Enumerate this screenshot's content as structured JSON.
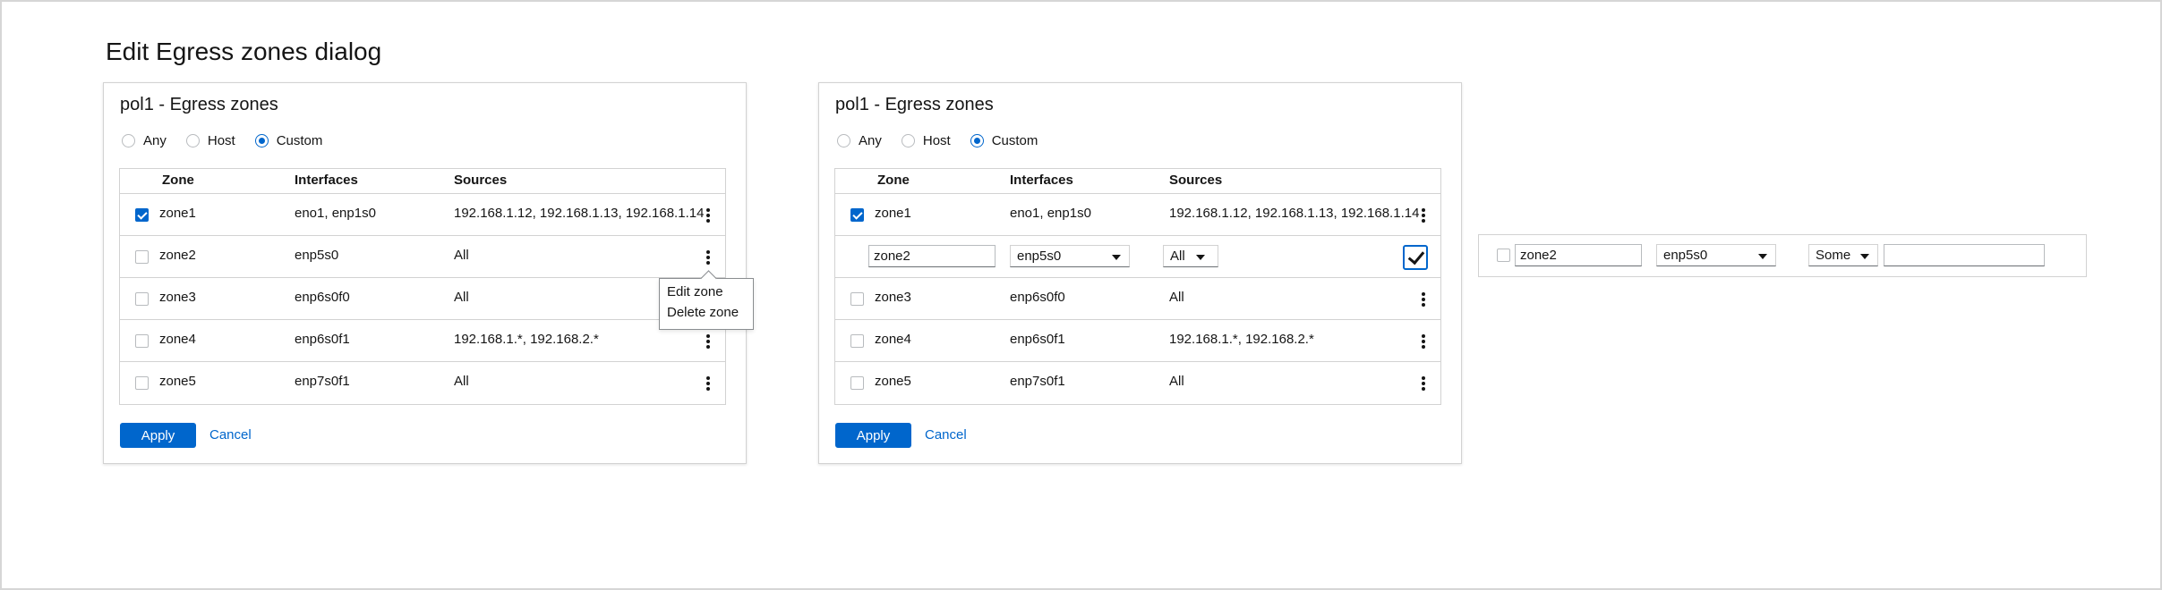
{
  "page_title": "Edit Egress zones dialog",
  "columns": {
    "zone": "Zone",
    "interfaces": "Interfaces",
    "sources": "Sources"
  },
  "radio_options": [
    "Any",
    "Host",
    "Custom"
  ],
  "selected_radio": "Custom",
  "colors": {
    "primary": "#0066cc",
    "border": "#d2d2d2",
    "text": "#151515"
  },
  "dialog_left": {
    "title": "pol1 - Egress zones",
    "rows": [
      {
        "zone": "zone1",
        "interfaces": "eno1, enp1s0",
        "sources": "192.168.1.12, 192.168.1.13, 192.168.1.14",
        "checked": true
      },
      {
        "zone": "zone2",
        "interfaces": "enp5s0",
        "sources": "All",
        "checked": false
      },
      {
        "zone": "zone3",
        "interfaces": "enp6s0f0",
        "sources": "All",
        "checked": false
      },
      {
        "zone": "zone4",
        "interfaces": "enp6s0f1",
        "sources": "192.168.1.*, 192.168.2.*",
        "checked": false
      },
      {
        "zone": "zone5",
        "interfaces": "enp7s0f1",
        "sources": "All",
        "checked": false
      }
    ],
    "kebab_menu": {
      "edit": "Edit zone",
      "delete": "Delete zone"
    },
    "apply_label": "Apply",
    "cancel_label": "Cancel"
  },
  "dialog_right": {
    "title": "pol1 - Egress zones",
    "rows": [
      {
        "zone": "zone1",
        "interfaces": "eno1, enp1s0",
        "sources": "192.168.1.12, 192.168.1.13, 192.168.1.14",
        "checked": true
      },
      {
        "zone": "zone3",
        "interfaces": "enp6s0f0",
        "sources": "All",
        "checked": false
      },
      {
        "zone": "zone4",
        "interfaces": "enp6s0f1",
        "sources": "192.168.1.*, 192.168.2.*",
        "checked": false
      },
      {
        "zone": "zone5",
        "interfaces": "enp7s0f1",
        "sources": "All",
        "checked": false
      }
    ],
    "edit_row": {
      "zone_value": "zone2",
      "interface_value": "enp5s0",
      "sources_value": "All"
    },
    "apply_label": "Apply",
    "cancel_label": "Cancel"
  },
  "edit_strip": {
    "zone_value": "zone2",
    "interface_value": "enp5s0",
    "sources_value": "Some",
    "sources_text": ""
  }
}
